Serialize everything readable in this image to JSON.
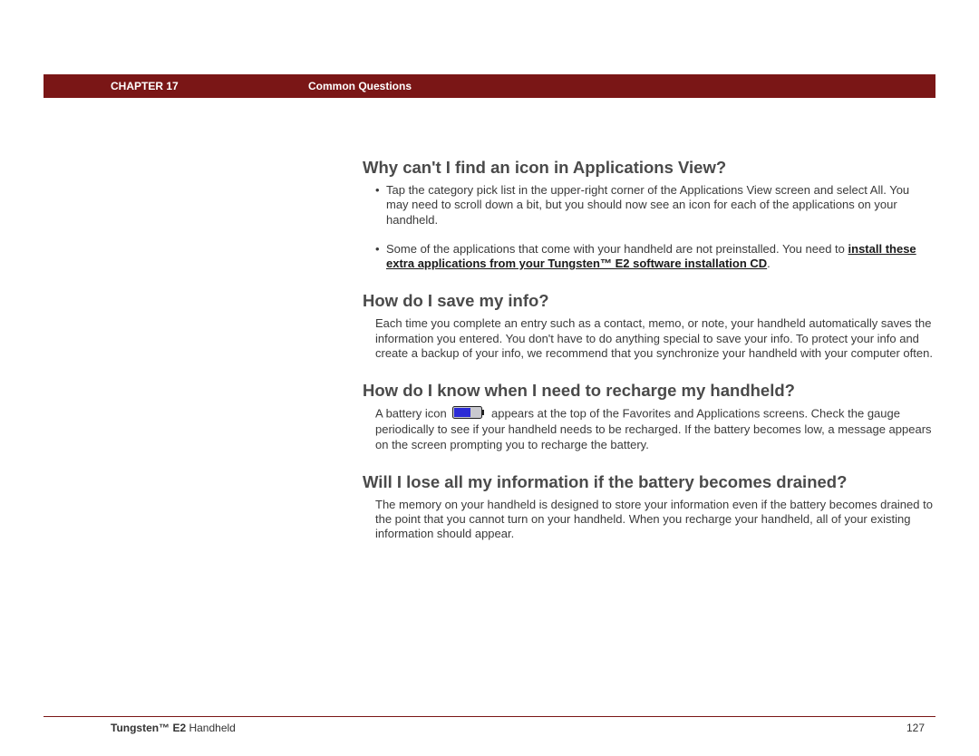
{
  "header": {
    "chapter": "CHAPTER 17",
    "title": "Common Questions"
  },
  "sections": {
    "q1": {
      "title": "Why can't I find an icon in Applications View?",
      "bullet1": "Tap the category pick list in the upper-right corner of the Applications View screen and select All. You may need to scroll down a bit, but you should now see an icon for each of the applications on your handheld.",
      "bullet2a": "Some of the applications that come with your handheld are not preinstalled. You need to ",
      "bullet2_link": "install these extra applications from your Tungsten™ E2  software installation CD",
      "bullet2b": "."
    },
    "q2": {
      "title": "How do I save my info?",
      "para": "Each time you complete an entry such as a contact, memo, or note, your handheld automatically saves the information you entered. You don't have to do anything special to save your info. To protect your info and create a backup of your info, we recommend that you synchronize your handheld with your computer often."
    },
    "q3": {
      "title": "How do I know when I need to recharge my handheld?",
      "para_a": "A battery icon ",
      "para_b": " appears at the top of the Favorites and Applications screens. Check the gauge periodically to see if your handheld needs to be recharged. If the battery becomes low, a message appears on the screen prompting you to recharge the battery."
    },
    "q4": {
      "title": "Will I lose all my information if the battery becomes drained?",
      "para": "The memory on your handheld is designed to store your information even if the battery becomes drained to the point that you cannot turn on your handheld. When you recharge your handheld, all of your existing information should appear."
    }
  },
  "footer": {
    "product_bold": "Tungsten™ E2",
    "product_rest": " Handheld",
    "page": "127"
  }
}
